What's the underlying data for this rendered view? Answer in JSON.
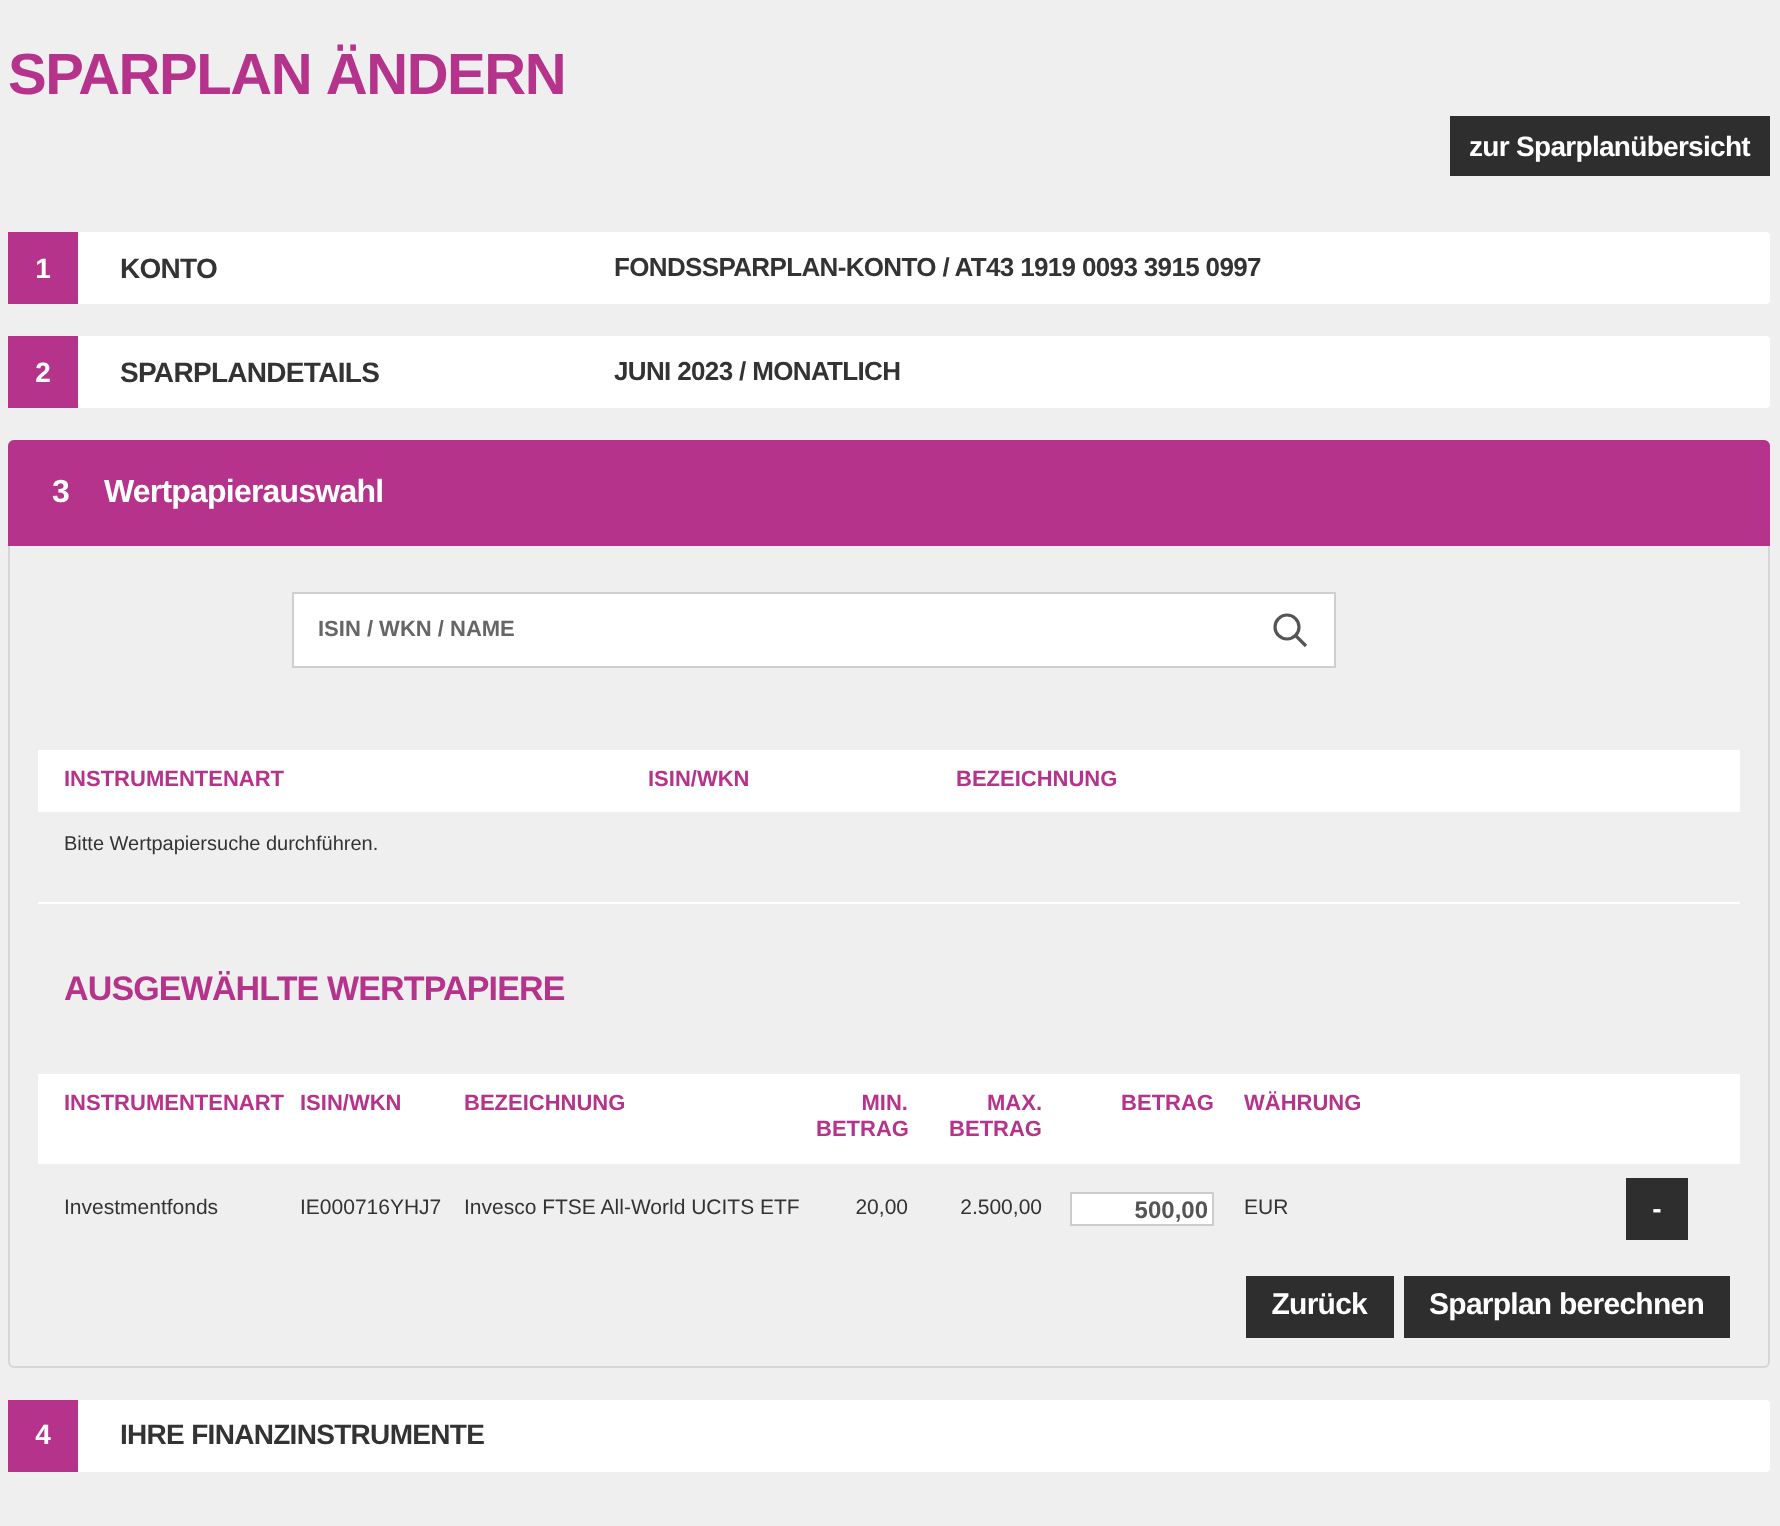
{
  "title": "SPARPLAN ÄNDERN",
  "overview_button": "zur Sparplanübersicht",
  "steps": [
    {
      "number": "1",
      "label": "KONTO",
      "summary": "FONDSSPARPLAN-KONTO / AT43 1919 0093 3915 0997",
      "expanded": false
    },
    {
      "number": "2",
      "label": "SPARPLANDETAILS",
      "summary": "JUNI 2023 / MONATLICH",
      "expanded": false
    },
    {
      "number": "3",
      "label": "Wertpapierauswahl",
      "expanded": true
    },
    {
      "number": "4",
      "label": "IHRE FINANZINSTRUMENTE",
      "expanded": false
    }
  ],
  "search": {
    "placeholder": "ISIN / WKN / NAME"
  },
  "results_table": {
    "columns": [
      "INSTRUMENTENART",
      "ISIN/WKN",
      "BEZEICHNUNG"
    ],
    "empty_message": "Bitte Wertpapiersuche durchführen."
  },
  "selected_heading": "AUSGEWÄHLTE WERTPAPIERE",
  "selected_table": {
    "columns": [
      "INSTRUMENTENART",
      "ISIN/WKN",
      "BEZEICHNUNG",
      "MIN. BETRAG",
      "MAX. BETRAG",
      "BETRAG",
      "WÄHRUNG"
    ],
    "rows": [
      {
        "type": "Investmentfonds",
        "isin": "IE000716YHJ7",
        "name": "Invesco FTSE All-World UCITS ETF",
        "min": "20,00",
        "max": "2.500,00",
        "amount": "500,00",
        "currency": "EUR",
        "remove": "-"
      }
    ]
  },
  "buttons": [
    "Zurück",
    "Sparplan berechnen"
  ]
}
